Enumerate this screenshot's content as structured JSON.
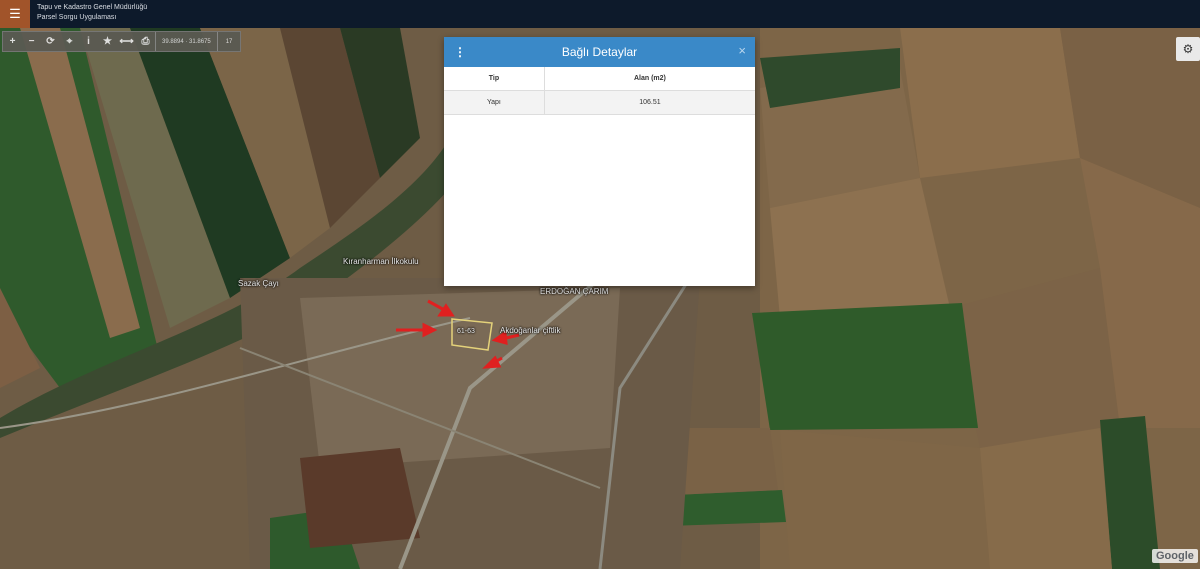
{
  "header": {
    "menu_icon": "☰",
    "title_line1": "Tapu ve Kadastro Genel Müdürlüğü",
    "title_line2": "Parsel Sorgu Uygulaması"
  },
  "toolbar": {
    "zoom_in": "+",
    "zoom_out": "−",
    "refresh": "⟳",
    "locate": "⌖",
    "info": "i",
    "favorite": "★",
    "measure": "⟷",
    "print": "⎙",
    "coordinates": "39.8894 · 31.8675",
    "zoom_level": "17"
  },
  "settings_icon": "⚙",
  "modal": {
    "menu_icon": "⋮",
    "title": "Bağlı Detaylar",
    "close_icon": "×",
    "columns": [
      "Tip",
      "Alan (m2)"
    ],
    "rows": [
      {
        "tip": "Yapı",
        "alan": "106.51"
      }
    ]
  },
  "map_labels": {
    "school": "Kıranharman İlkokulu",
    "stream": "Sazak Çayı",
    "business": "ERDOĞAN ÇARIM",
    "farm": "Akdoğanlar çiftlik",
    "parcel": "61-63"
  },
  "attribution": "Google"
}
